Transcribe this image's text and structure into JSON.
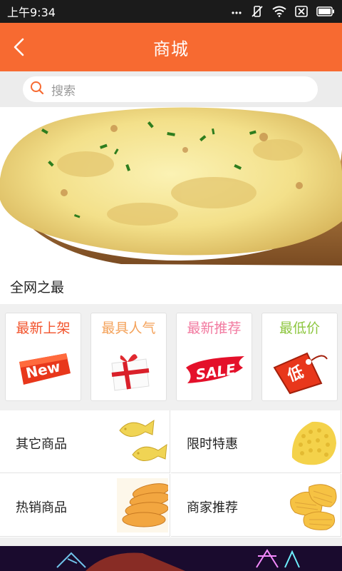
{
  "statusbar": {
    "time": "上午9:34"
  },
  "navbar": {
    "title": "商城"
  },
  "search": {
    "placeholder": "搜索"
  },
  "section": {
    "title": "全网之最"
  },
  "promos": [
    {
      "label": "最新上架",
      "color": "#f2542d",
      "art": "new-badge"
    },
    {
      "label": "最具人气",
      "color": "#f4a25a",
      "art": "gift-box"
    },
    {
      "label": "最新推荐",
      "color": "#f27aa0",
      "art": "sale-tag"
    },
    {
      "label": "最低价",
      "color": "#8dc63f",
      "art": "low-price-tag"
    }
  ],
  "categories": [
    {
      "label": "其它商品"
    },
    {
      "label": "限时特惠"
    },
    {
      "label": "热销商品"
    },
    {
      "label": "商家推荐"
    }
  ],
  "colors": {
    "accent": "#f76a31",
    "statusbar": "#1b1b1b"
  }
}
